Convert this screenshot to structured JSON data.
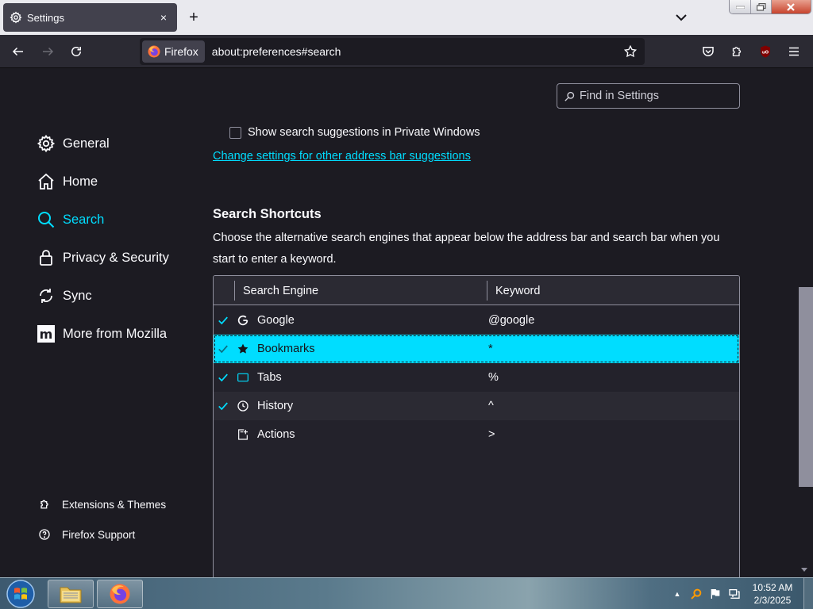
{
  "browser": {
    "tab": {
      "title": "Settings",
      "close_glyph": "×"
    },
    "new_tab_glyph": "+",
    "identity_label": "Firefox",
    "url": "about:preferences#search"
  },
  "search_field": {
    "placeholder": "Find in Settings"
  },
  "sidebar": {
    "categories": [
      {
        "label": "General",
        "icon": "gear-icon"
      },
      {
        "label": "Home",
        "icon": "home-icon"
      },
      {
        "label": "Search",
        "icon": "search-icon",
        "selected": true
      },
      {
        "label": "Privacy & Security",
        "icon": "lock-icon"
      },
      {
        "label": "Sync",
        "icon": "sync-icon"
      },
      {
        "label": "More from Mozilla",
        "icon": "mozilla-icon"
      }
    ],
    "footer": [
      {
        "label": "Extensions & Themes",
        "icon": "puzzle-icon"
      },
      {
        "label": "Firefox Support",
        "icon": "help-icon"
      }
    ]
  },
  "content": {
    "cutoff_checkbox_label": "Show search suggestions in Private Windows",
    "address_bar_link": "Change settings for other address bar suggestions",
    "shortcuts": {
      "title": "Search Shortcuts",
      "description": "Choose the alternative search engines that appear below the address bar and search bar when you start to enter a keyword.",
      "columns": [
        "Search Engine",
        "Keyword"
      ],
      "rows": [
        {
          "checked": true,
          "name": "Google",
          "keyword": "@google",
          "icon": "google-icon"
        },
        {
          "checked": true,
          "name": "Bookmarks",
          "keyword": "*",
          "icon": "star-icon",
          "selected": true
        },
        {
          "checked": true,
          "name": "Tabs",
          "keyword": "%",
          "icon": "tab-icon"
        },
        {
          "checked": true,
          "name": "History",
          "keyword": "^",
          "icon": "clock-icon"
        },
        {
          "checked": false,
          "name": "Actions",
          "keyword": ">",
          "icon": "actions-icon"
        }
      ]
    }
  },
  "taskbar": {
    "time": "10:52 AM",
    "date": "2/3/2025"
  },
  "colors": {
    "accent": "#00ddff",
    "page_bg": "#1c1b22",
    "toolbar_bg": "#2b2a33"
  }
}
